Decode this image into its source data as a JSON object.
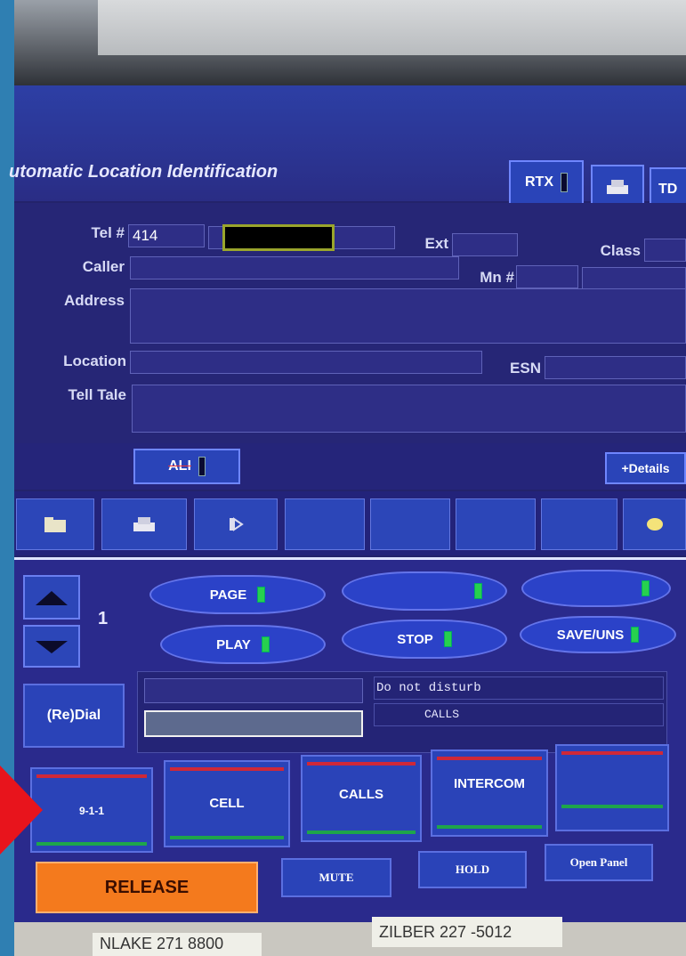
{
  "app": {
    "title": "utomatic Location Identification",
    "header_buttons": {
      "rtx": "RTX",
      "td": "TD"
    }
  },
  "ali_form": {
    "tel_label": "Tel #",
    "tel_value": "414",
    "ext_label": "Ext",
    "class_label": "Class",
    "caller_label": "Caller",
    "mn_label": "Mn #",
    "address_label": "Address",
    "location_label": "Location",
    "esn_label": "ESN",
    "telltale_label": "Tell Tale"
  },
  "ali_bar": {
    "ali_button": "ALI",
    "details_button": "+Details"
  },
  "call_panel": {
    "line_number": "1",
    "ovals": [
      {
        "label": "PAGE"
      },
      {
        "label": ""
      },
      {
        "label": ""
      },
      {
        "label": "PLAY"
      },
      {
        "label": "STOP"
      },
      {
        "label": "SAVE/UNS"
      }
    ],
    "redial_label": "(Re)Dial",
    "status_dnd": "Do not disturb",
    "status_calls": "CALLS"
  },
  "line_keys": [
    "9-1-1",
    "CELL",
    "CALLS",
    "INTERCOM",
    ""
  ],
  "bottom_buttons": {
    "release": "RELEASE",
    "mute": "MUTE",
    "hold": "HOLD",
    "open_panel": "Open Panel"
  },
  "stickers": {
    "left": "NLAKE 271 8800",
    "right": "ZILBER 227 -5012"
  },
  "colors": {
    "accent": "#2a43b8",
    "release": "#f47a1d",
    "led_on": "#27d04e",
    "alert_arrow": "#e8141c"
  }
}
